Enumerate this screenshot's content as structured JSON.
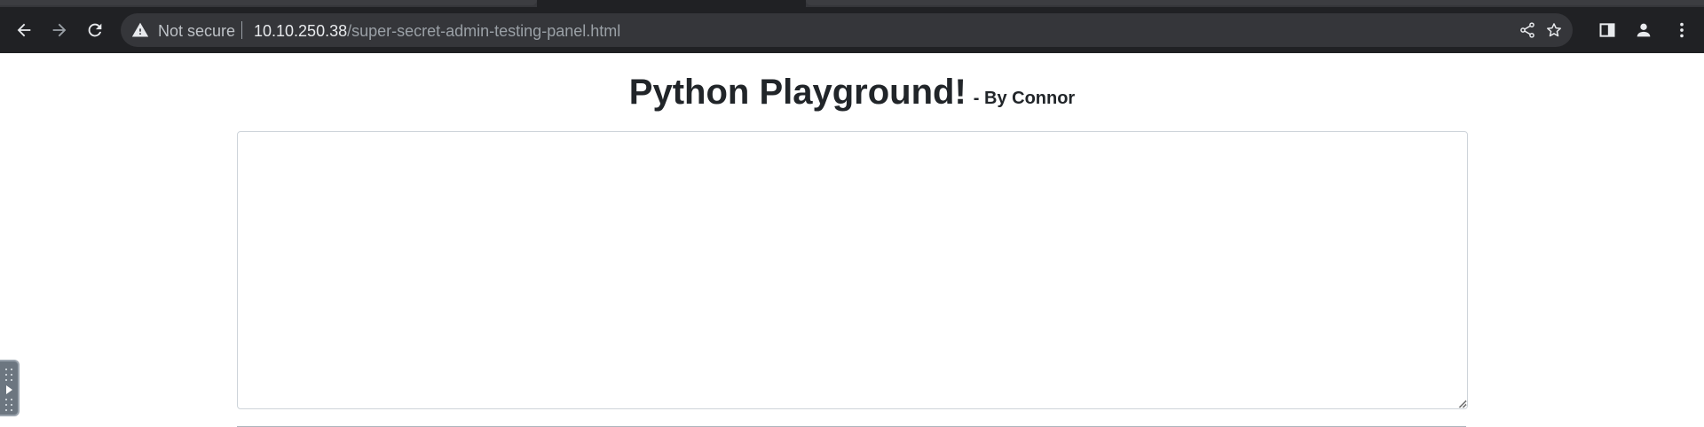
{
  "browser": {
    "security_label": "Not secure",
    "url_host": "10.10.250.38",
    "url_path": "/super-secret-admin-testing-panel.html",
    "icons": {
      "back": "back-arrow-icon",
      "forward": "forward-arrow-icon",
      "reload": "reload-icon",
      "warning": "warning-triangle-icon",
      "share": "share-icon",
      "bookmark": "star-icon",
      "sidepanel": "side-panel-icon",
      "profile": "profile-icon",
      "menu": "kebab-menu-icon"
    }
  },
  "page": {
    "title": "Python Playground!",
    "byline": "- By Connor",
    "code_input_value": ""
  },
  "colors": {
    "chrome_bg": "#202124",
    "omnibox_bg": "#35363a",
    "text": "#212529",
    "border": "#ced4da"
  }
}
